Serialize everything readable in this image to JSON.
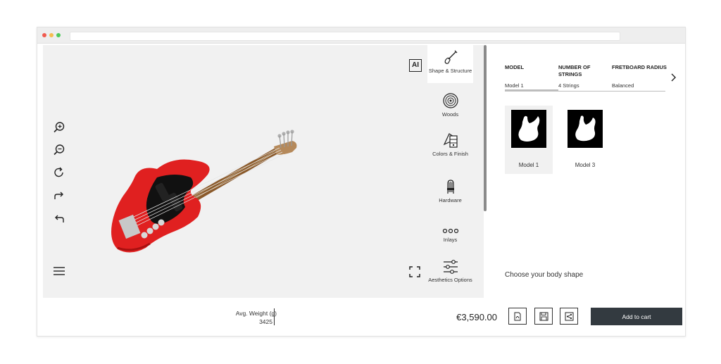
{
  "browser": {
    "colors": {
      "close": "#f05a4f",
      "minimize": "#f5bd4f",
      "maximize": "#4ec95a"
    }
  },
  "viewer": {
    "ai_label": "AI",
    "tools": [
      "zoom-in-icon",
      "zoom-out-icon",
      "refresh-icon",
      "redo-icon",
      "undo-icon"
    ],
    "guitar_color": "#e02020"
  },
  "categories": [
    {
      "label": "Shape & Structure",
      "icon": "guitar-icon",
      "active": true
    },
    {
      "label": "Woods",
      "icon": "wood-rings-icon",
      "active": false
    },
    {
      "label": "Colors & Finish",
      "icon": "palette-icon",
      "active": false
    },
    {
      "label": "Hardware",
      "icon": "hardware-icon",
      "active": false
    },
    {
      "label": "Inlays",
      "icon": "dots-icon",
      "active": false
    },
    {
      "label": "Aesthetics Options",
      "icon": "sliders-icon",
      "active": false
    }
  ],
  "panel": {
    "columns": [
      {
        "header": "MODEL",
        "value": "Model 1"
      },
      {
        "header": "NUMBER OF STRINGS",
        "value": "4 Strings"
      },
      {
        "header": "FRETBOARD RADIUS",
        "value": "Balanced"
      }
    ],
    "options": [
      {
        "name": "Model 1",
        "selected": true
      },
      {
        "name": "Model 3",
        "selected": false
      }
    ],
    "hint": "Choose your body shape"
  },
  "footer": {
    "weight_label": "Avg. Weight (g)",
    "weight_value": "3425",
    "price": "€3,590.00",
    "add_to_cart": "Add to cart"
  }
}
